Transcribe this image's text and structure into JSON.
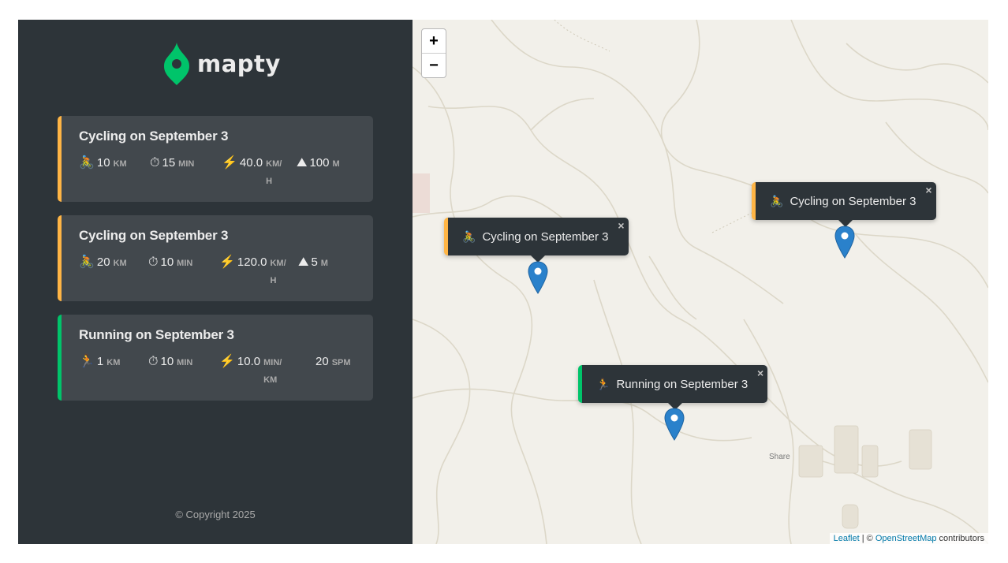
{
  "brand": {
    "name": "mapty",
    "accent": "#00c46a"
  },
  "colors": {
    "cycling": "#ffb545",
    "running": "#00c46a",
    "sidebar": "#2d3439",
    "card": "#42484d"
  },
  "workouts": [
    {
      "type": "cycling",
      "title": "Cycling on September 3",
      "type_icon": "🚴",
      "distance": "10",
      "distance_unit": "KM",
      "duration": "15",
      "duration_unit": "MIN",
      "speed_icon": "⚡",
      "speed": "40.0",
      "speed_unit": "KM/H",
      "elev_icon": "⛰",
      "elevation": "100",
      "elevation_unit": "M"
    },
    {
      "type": "cycling",
      "title": "Cycling on September 3",
      "type_icon": "🚴",
      "distance": "20",
      "distance_unit": "KM",
      "duration": "10",
      "duration_unit": "MIN",
      "speed_icon": "⚡",
      "speed": "120.0",
      "speed_unit": "KM/H",
      "elev_icon": "⛰",
      "elevation": "5",
      "elevation_unit": "M"
    },
    {
      "type": "running",
      "title": "Running on September 3",
      "type_icon": "🏃",
      "distance": "1",
      "distance_unit": "KM",
      "duration": "10",
      "duration_unit": "MIN",
      "speed_icon": "⚡",
      "speed": "10.0",
      "speed_unit": "MIN/KM",
      "elev_icon": "",
      "elevation": "20",
      "elevation_unit": "SPM"
    }
  ],
  "footer": {
    "copyright": "© Copyright 2025"
  },
  "map": {
    "zoom_in": "+",
    "zoom_out": "−",
    "popups": [
      {
        "icon": "🚴",
        "label": "Cycling on September 3",
        "close": "×"
      },
      {
        "icon": "🚴",
        "label": "Cycling on September 3",
        "close": "×"
      },
      {
        "icon": "🏃",
        "label": "Running on September 3",
        "close": "×"
      }
    ],
    "place_label": "Share",
    "attribution": {
      "leaflet": "Leaflet",
      "sep": " | © ",
      "osm": "OpenStreetMap",
      "tail": " contributors"
    }
  },
  "icons": {
    "timer": "⏱",
    "marker": "map-marker-icon",
    "logo": "location-pin-icon"
  }
}
